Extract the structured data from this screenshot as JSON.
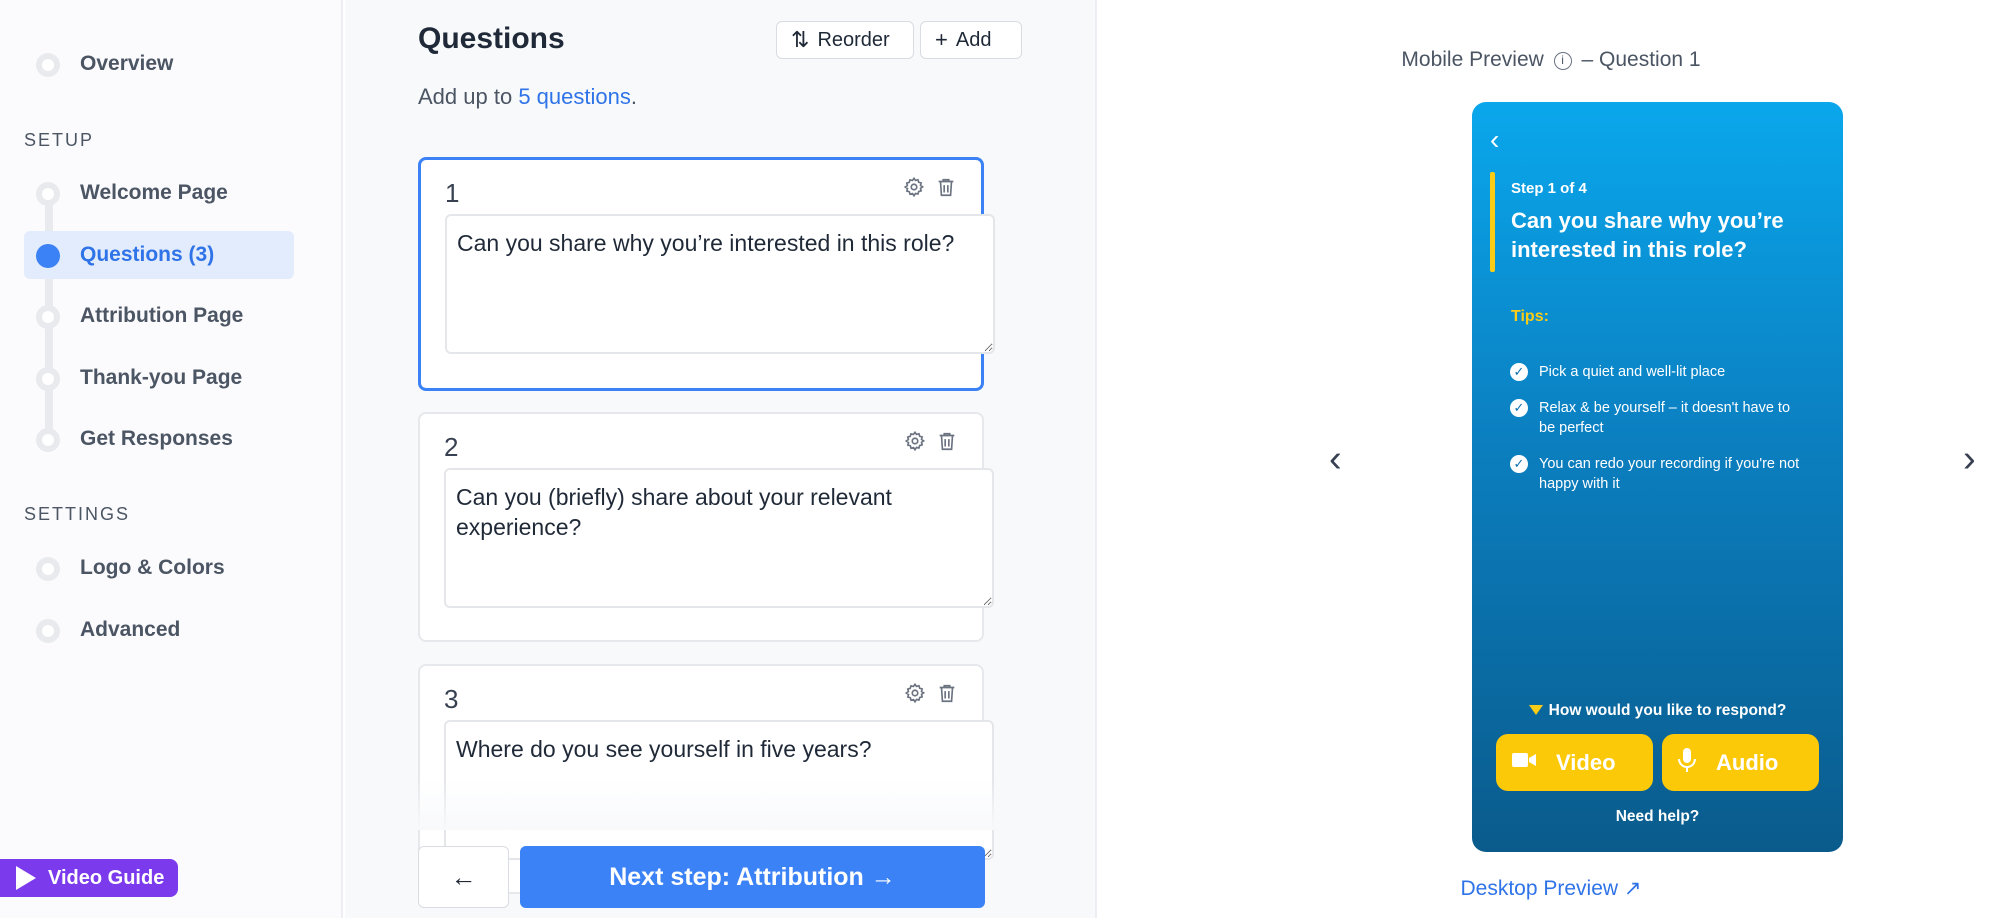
{
  "sidebar": {
    "overview": "Overview",
    "setup_label": "SETUP",
    "setup_items": [
      "Welcome Page",
      "Questions (3)",
      "Attribution Page",
      "Thank-you Page",
      "Get Responses"
    ],
    "settings_label": "SETTINGS",
    "settings_items": [
      "Logo & Colors",
      "Advanced"
    ],
    "video_guide": "Video Guide"
  },
  "main": {
    "title": "Questions",
    "reorder_label": "Reorder",
    "add_label": "Add",
    "subtitle_prefix": "Add up to ",
    "subtitle_link": "5 questions",
    "subtitle_suffix": ".",
    "questions": [
      {
        "number": "1",
        "text": "Can you share why you’re interested in this role?"
      },
      {
        "number": "2",
        "text": "Can you (briefly) share about your relevant experience?"
      },
      {
        "number": "3",
        "text": "Where do you see yourself in five years?"
      }
    ],
    "back_label": "←",
    "next_label": "Next step: Attribution →"
  },
  "preview": {
    "title_left": "Mobile Preview",
    "title_right": "– Question 1",
    "phone": {
      "step": "Step 1 of 4",
      "question": "Can you share why you’re interested in this role?",
      "tips_label": "Tips:",
      "tips": [
        "Pick a quiet and well-lit place",
        "Relax & be yourself – it doesn't have to be perfect",
        "You can redo your recording if you're not happy with it"
      ],
      "respond_prompt": "How would you like to respond?",
      "video_label": "Video",
      "audio_label": "Audio",
      "help": "Need help?"
    },
    "desktop_link": "Desktop Preview ↗"
  },
  "colors": {
    "accent": "#3b82f6",
    "video_guide": "#7c3aed",
    "phone_button": "#fcc909",
    "phone_bg_top": "#0aa7ec",
    "phone_bg_bottom": "#0a5b8c"
  }
}
